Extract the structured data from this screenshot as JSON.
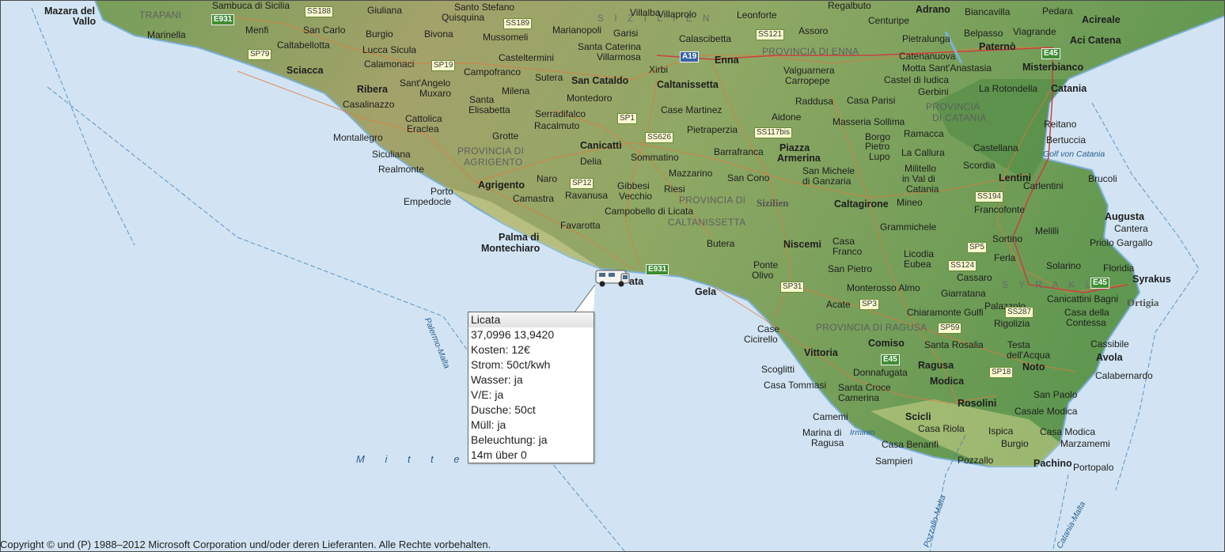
{
  "map": {
    "copyright": "Copyright © und (P) 1988–2012 Microsoft Corporation und/oder deren Lieferanten. Alle Rechte vorbehalten.",
    "sea_label": "M i t t e l m e e r",
    "region_labels": {
      "sizilien_top": "S I Z I L I E N",
      "syrakus": "S Y R A K U S",
      "trapani": "TRAPANI",
      "sizilien": "Sizilien",
      "ortigia": "Ortigia"
    },
    "province_labels": {
      "enna": "PROVINCIA DI ENNA",
      "catania_1": "PROVINCIA",
      "catania_2": "DI CATANIA",
      "agrigento_1": "PROVINCIA DI",
      "agrigento_2": "AGRIGENTO",
      "caltanissetta_1": "PROVINCIA DI",
      "caltanissetta_2": "CALTANISSETTA",
      "ragusa": "PROVINCIA DI RAGUSA"
    },
    "water_labels": {
      "golf_catania": "Golf von Catania",
      "palermo_malta": "Palermo-Malta",
      "pozzallo_malta": "Pozzallo-Malta",
      "catania_malta": "Catania-Malta",
      "irminio": "Irminio"
    },
    "cities": {
      "mazara1": "Mazara del",
      "mazara2": "Vallo",
      "sciacca": "Sciacca",
      "ribera": "Ribera",
      "agrigento": "Agrigento",
      "palma1": "Palma di",
      "palma2": "Montechiaro",
      "sancataldo": "San Cataldo",
      "caltanissetta": "Caltanissetta",
      "enna": "Enna",
      "canicatti": "Canicattì",
      "gela": "Gela",
      "niscemi": "Niscemi",
      "caltagirone": "Caltagirone",
      "piazza1": "Piazza",
      "piazza2": "Armerina",
      "vittoria": "Vittoria",
      "comiso": "Comiso",
      "ragusa": "Ragusa",
      "modica": "Modica",
      "scicli": "Scicli",
      "rosolini": "Rosolini",
      "noto": "Noto",
      "avola": "Avola",
      "pachino": "Pachino",
      "syrakus": "Syrakus",
      "augusta": "Augusta",
      "lentini": "Lentini",
      "catania": "Catania",
      "adrano": "Adrano",
      "paterno": "Paternò",
      "acireale": "Acireale",
      "acicatena": "Aci Catena",
      "misterbianco": "Misterbianco",
      "licata_part": "ata"
    },
    "towns": {
      "sambuca": "Sambuca di Sicilia",
      "santostefano": "Santo Stefano",
      "quisquina": "Quisquina",
      "giuliana": "Giuliana",
      "marinella": "Marinella",
      "menfi": "Menfi",
      "sancarlo": "San Carlo",
      "caltabellotta": "Caltabellotta",
      "burgio": "Burgio",
      "bivona": "Bivona",
      "lucca": "Lucca Sicula",
      "calamonaci": "Calamonaci",
      "santangelo": "Sant'Angelo",
      "muxaro": "Muxaro",
      "casalinazzo": "Casalinazzo",
      "santa": "Santa",
      "elisabetta": "Elisabetta",
      "cattolica": "Cattolica",
      "eraclea": "Eraclea",
      "montallegro": "Montallegro",
      "siculiana": "Siculiana",
      "realmonte": "Realmonte",
      "porto": "Porto",
      "empedocle": "Empedocle",
      "mussomeli": "Mussomeli",
      "casteltermini": "Casteltermini",
      "campofranco": "Campofranco",
      "sutera": "Sutera",
      "milena": "Milena",
      "serradifalco": "Serradifalco",
      "racalmuto": "Racalmuto",
      "grotte": "Grotte",
      "montedoro": "Montedoro",
      "marianopoli": "Marianopoli",
      "santacaterina": "Santa Caterina",
      "villarmosa": "Villarmosa",
      "garisi": "Garisi",
      "villalba": "Villalba",
      "xirbi": "Xirbi",
      "villaprolo": "Villaprolo",
      "calascibetta": "Calascibetta",
      "leonforte": "Leonforte",
      "regalbuto": "Regalbuto",
      "assoro": "Assoro",
      "centuripe": "Centuripe",
      "biancavilla": "Biancavilla",
      "pedara": "Pedara",
      "viagrande": "Viagrande",
      "belpasso": "Belpasso",
      "pietralunga": "Pietralunga",
      "catenanuova": "Catenanuova",
      "mottasa": "Motta Sant'Anastasia",
      "castel": "Castel di Iudica",
      "gerbini": "Gerbini",
      "rotondella": "La Rotondella",
      "valguarnera": "Valguarnera",
      "carrapepe": "Carropepe",
      "raddusa": "Raddusa",
      "casaparisi": "Casa Parisi",
      "casemartinez": "Case Martinez",
      "pietraperzia": "Pietraperzia",
      "aidone": "Aidone",
      "masseria": "Masseria Sollima",
      "ramacca": "Ramacca",
      "reitano": "Reitano",
      "bertuccia": "Bertuccia",
      "barrafranca": "Barrafranca",
      "borgo": "Borgo",
      "pietro": "Pietro",
      "lupo": "Lupo",
      "lacallura": "La Callura",
      "castellana": "Castellana",
      "delia": "Delia",
      "sommatino": "Sommatino",
      "mazzarino": "Mazzarino",
      "sancono": "San Cono",
      "sanmichele": "San Michele",
      "digranzaria": "di Ganzaria",
      "militello": "Militello",
      "invaldi": "in Val di",
      "catania2": "Catania",
      "scordia": "Scordia",
      "carlentini": "Carlentini",
      "brucoli": "Brucoli",
      "naro": "Naro",
      "camastra": "Camastra",
      "ravanusa": "Ravanusa",
      "gibbesi": "Gibbesi",
      "vecchio": "Vecchio",
      "riesi": "Riesi",
      "campobello": "Campobello di Licata",
      "mineo": "Mineo",
      "francofonte": "Francofonte",
      "cantera": "Cantera",
      "priolo": "Priolo Gargallo",
      "favarotta": "Favarotta",
      "grammichele": "Grammichele",
      "melilli": "Melilli",
      "sortino": "Sortino",
      "butera": "Butera",
      "casafranco1": "Casa",
      "casafranco2": "Franco",
      "licodia": "Licodia",
      "eubea": "Eubea",
      "ferla": "Ferla",
      "solarino": "Solarino",
      "floridia": "Floridia",
      "ponteolivo1": "Ponte",
      "ponteolivo2": "Olivo",
      "sanpietro": "San Pietro",
      "cassaro": "Cassaro",
      "monterosso": "Monterosso Almo",
      "giarratana": "Giarratana",
      "canicattini": "Canicattini Bagni",
      "acate": "Acate",
      "chiaramonte": "Chiaramonte Gulfi",
      "palazzolo": "Palazzolo",
      "casadella": "Casa della",
      "contessa": "Contessa",
      "case": "Case",
      "cicirello": "Cicirello",
      "rigolizia": "Rigolizia",
      "santarosalia": "Santa Rosalia",
      "testa": "Testa",
      "dellacqua": "dell'Acqua",
      "cassibile": "Cassibile",
      "scoglitti": "Scoglitti",
      "donnafugata": "Donnafugata",
      "calabernardo": "Calabernardo",
      "casatommasi": "Casa Tommasi",
      "santacroce": "Santa Croce",
      "camerina": "Camerina",
      "sanpaolo": "San Paolo",
      "camemi": "Camemi",
      "casalemodica": "Casale Modica",
      "casariola": "Casa Riola",
      "ispica": "Ispica",
      "casamodica": "Casa Modica",
      "marinadi": "Marina di",
      "ragusa2": "Ragusa",
      "casabenarifi": "Casa Benarifi",
      "burgio2": "Burgio",
      "marzamemi": "Marzamemi",
      "sampieri": "Sampieri",
      "pozzallo": "Pozzallo",
      "portopalo": "Portopalo"
    },
    "shields": {
      "e931a": "E931",
      "ss188": "SS188",
      "sp79": "SP79",
      "sp19": "SP19",
      "ss189": "SS189",
      "a19": "A19",
      "ss121": "SS121",
      "e45a": "E45",
      "sp1": "SP1",
      "ss626": "SS626",
      "ss117": "SS117bis",
      "sp12": "SP12",
      "ss194": "SS194",
      "e931b": "E931",
      "sp5": "SP5",
      "ss124": "SS124",
      "sp31": "SP31",
      "e45b": "E45",
      "sp3": "SP3",
      "ss287": "SS287",
      "sp59": "SP59",
      "e45c": "E45",
      "sp18": "SP18"
    }
  },
  "popup": {
    "title": "Licata",
    "lines": [
      "37,0996 13,9420",
      "Kosten: 12€",
      "Strom: 50ct/kwh",
      "Wasser: ja",
      "V/E: ja",
      "Dusche: 50ct",
      "Müll: ja",
      "Beleuchtung: ja",
      "14m über 0"
    ]
  }
}
